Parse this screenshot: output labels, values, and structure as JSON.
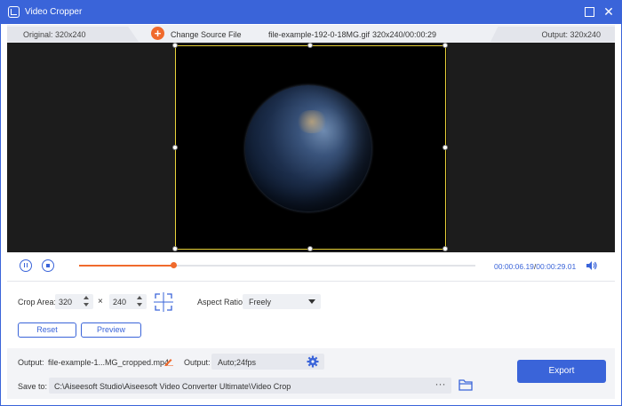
{
  "window": {
    "title": "Video Cropper",
    "maximize_icon": "maximize-icon",
    "close_glyph": "✕"
  },
  "infobar": {
    "original_label": "Original: 320x240",
    "change_source_label": "Change Source File",
    "add_glyph": "+",
    "file_name": "file-example-192-0-18MG.gif",
    "file_info": "320x240/00:00:29",
    "output_label": "Output: 320x240"
  },
  "playback": {
    "current_time": "00:00:06.19",
    "separator": "/",
    "total_time": "00:00:29.01",
    "progress_fraction": 0.238
  },
  "crop": {
    "label": "Crop Area:",
    "width": "320",
    "times_glyph": "×",
    "height": "240",
    "aspect_label": "Aspect Ratio:",
    "aspect_value": "Freely",
    "reset_label": "Reset",
    "preview_label": "Preview"
  },
  "output": {
    "name_label": "Output:",
    "file_name": "file-example-1...MG_cropped.mp4",
    "format_label": "Output:",
    "format_value": "Auto;24fps",
    "save_label": "Save to:",
    "save_path": "C:\\Aiseesoft Studio\\Aiseesoft Video Converter Ultimate\\Video Crop",
    "more_glyph": "···",
    "export_label": "Export"
  },
  "colors": {
    "accent": "#3a64d9",
    "progress": "#f06a2c",
    "crop_border": "#e9d23a"
  }
}
